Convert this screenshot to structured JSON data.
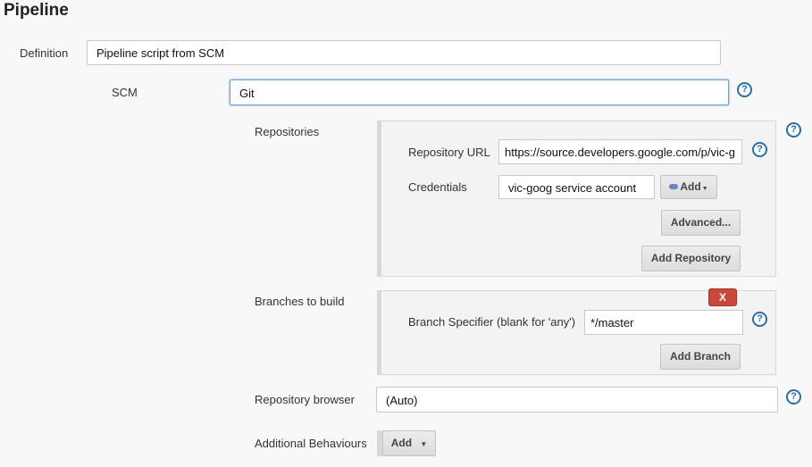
{
  "section": {
    "title": "Pipeline"
  },
  "definition": {
    "label": "Definition",
    "value": "Pipeline script from SCM"
  },
  "scm": {
    "label": "SCM",
    "value": "Git"
  },
  "repositories": {
    "label": "Repositories",
    "url_label": "Repository URL",
    "url_value": "https://source.developers.google.com/p/vic-g",
    "credentials_label": "Credentials",
    "credentials_value": "vic-goog service account",
    "add_label": "Add",
    "advanced_label": "Advanced...",
    "add_repository_label": "Add Repository"
  },
  "branches": {
    "label": "Branches to build",
    "remove_label": "X",
    "specifier_label": "Branch Specifier (blank for 'any')",
    "specifier_value": "*/master",
    "add_branch_label": "Add Branch"
  },
  "repo_browser": {
    "label": "Repository browser",
    "value": "(Auto)"
  },
  "behaviours": {
    "label": "Additional Behaviours",
    "add_label": "Add"
  },
  "help_glyph": "?",
  "caret_glyph": "▼",
  "colors": {
    "help": "#2e6da4",
    "remove": "#c9473b",
    "focus": "#6aa1d8"
  },
  "icons": [
    "help-icon",
    "dropdown-caret-icon",
    "key-icon"
  ]
}
